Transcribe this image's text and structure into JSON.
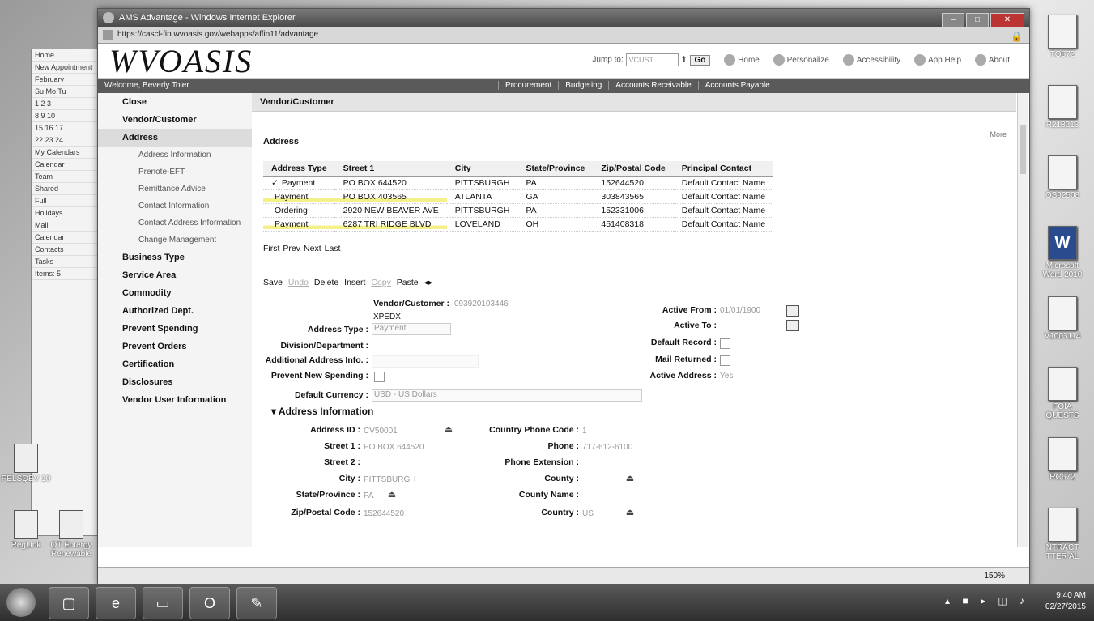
{
  "window": {
    "title": "AMS Advantage - Windows Internet Explorer",
    "url": "https://cascl-fin.wvoasis.gov/webapps/affin11/advantage",
    "zoom": "150%"
  },
  "header": {
    "brand": "WVOASIS",
    "jump_label": "Jump to:",
    "jump_value": "VCUST",
    "go_label": "Go",
    "links": [
      "Home",
      "Personalize",
      "Accessibility",
      "App Help",
      "About"
    ]
  },
  "navbar": {
    "welcome": "Welcome, Beverly Toler",
    "menu": [
      "Procurement",
      "Budgeting",
      "Accounts Receivable",
      "Accounts Payable"
    ]
  },
  "leftnav": {
    "items": [
      {
        "label": "Close",
        "type": "item"
      },
      {
        "label": "Vendor/Customer",
        "type": "item"
      },
      {
        "label": "Address",
        "type": "item",
        "active": true
      },
      {
        "label": "Address Information",
        "type": "sub"
      },
      {
        "label": "Prenote-EFT",
        "type": "sub"
      },
      {
        "label": "Remittance Advice",
        "type": "sub"
      },
      {
        "label": "Contact Information",
        "type": "sub"
      },
      {
        "label": "Contact Address Information",
        "type": "sub"
      },
      {
        "label": "Change Management",
        "type": "sub"
      },
      {
        "label": "Business Type",
        "type": "item"
      },
      {
        "label": "Service Area",
        "type": "item"
      },
      {
        "label": "Commodity",
        "type": "item"
      },
      {
        "label": "Authorized Dept.",
        "type": "item"
      },
      {
        "label": "Prevent Spending",
        "type": "item"
      },
      {
        "label": "Prevent Orders",
        "type": "item"
      },
      {
        "label": "Certification",
        "type": "item"
      },
      {
        "label": "Disclosures",
        "type": "item"
      },
      {
        "label": "Vendor User Information",
        "type": "item"
      }
    ]
  },
  "main": {
    "breadcrumb": "Vendor/Customer",
    "section_title": "Address",
    "more_link": "More",
    "columns": [
      "Address Type",
      "Street 1",
      "City",
      "State/Province",
      "Zip/Postal Code",
      "Principal Contact"
    ],
    "rows": [
      {
        "check": "✓",
        "type": "Payment",
        "street": "PO BOX 644520",
        "city": "PITTSBURGH",
        "state": "PA",
        "zip": "152644520",
        "contact": "Default Contact Name",
        "highlight": false
      },
      {
        "check": "",
        "type": "Payment",
        "street": "PO BOX 403565",
        "city": "ATLANTA",
        "state": "GA",
        "zip": "303843565",
        "contact": "Default Contact Name",
        "highlight": true
      },
      {
        "check": "",
        "type": "Ordering",
        "street": "2920 NEW BEAVER AVE",
        "city": "PITTSBURGH",
        "state": "PA",
        "zip": "152331006",
        "contact": "Default Contact Name",
        "highlight": false
      },
      {
        "check": "",
        "type": "Payment",
        "street": "6287 TRI RIDGE BLVD",
        "city": "LOVELAND",
        "state": "OH",
        "zip": "451408318",
        "contact": "Default Contact Name",
        "highlight": true
      }
    ],
    "pager": [
      "First",
      "Prev",
      "Next",
      "Last"
    ],
    "actions": {
      "save": "Save",
      "undo": "Undo",
      "delete": "Delete",
      "insert": "Insert",
      "copy": "Copy",
      "paste": "Paste"
    }
  },
  "form": {
    "vendor_customer_label": "Vendor/Customer :",
    "vendor_customer_value": "093920103446",
    "vendor_name": "XPEDX",
    "address_type_label": "Address Type :",
    "address_type_value": "Payment",
    "division_label": "Division/Department :",
    "additional_label": "Additional Address Info. :",
    "prevent_new_label": "Prevent New Spending :",
    "currency_label": "Default Currency :",
    "currency_value": "USD - US Dollars",
    "active_from_label": "Active From :",
    "active_from_value": "01/01/1900",
    "active_to_label": "Active To :",
    "default_record_label": "Default Record :",
    "mail_returned_label": "Mail Returned :",
    "active_address_label": "Active Address :",
    "active_address_value": "Yes",
    "addr_info_heading": "Address Information",
    "address_id_label": "Address ID :",
    "address_id_value": "CV50001",
    "street1_label": "Street 1 :",
    "street1_value": "PO BOX 644520",
    "street2_label": "Street 2 :",
    "city_label": "City :",
    "city_value": "PITTSBURGH",
    "state_label": "State/Province :",
    "state_value": "PA",
    "zip_label": "Zip/Postal Code :",
    "zip_value": "152644520",
    "country_phone_label": "Country Phone Code :",
    "country_phone_value": "1",
    "phone_label": "Phone :",
    "phone_value": "717-612-6100",
    "phone_ext_label": "Phone Extension :",
    "county_label": "County :",
    "county_name_label": "County Name :",
    "country_label": "Country :",
    "country_value": "US"
  },
  "desktop": {
    "right_icons": [
      "TO572",
      "R213213",
      "OS92508",
      "Microsoft Word 2010",
      "V1003114",
      "FOIA QUESTS",
      "RC672",
      "NTRACT TTER AL"
    ],
    "left_icons": [
      "PELSQEV 10",
      "RegLink",
      "OT Entergy Renewable"
    ],
    "outlook_rows": [
      "Home",
      "New Appointment",
      "February",
      "Su Mo Tu",
      "1 2 3",
      "8 9 10",
      "15 16 17",
      "22 23 24",
      "My Calendars",
      "Calendar",
      "Team",
      "Shared",
      "Full",
      "Holidays",
      "Mail",
      "Calendar",
      "Contacts",
      "Tasks",
      "Items: 5"
    ]
  },
  "taskbar": {
    "time": "9:40 AM",
    "date": "02/27/2015"
  }
}
